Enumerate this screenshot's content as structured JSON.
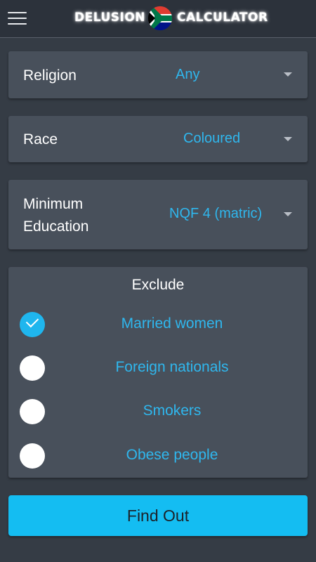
{
  "header": {
    "logo_left": "DELUSION",
    "logo_right": "CALCULATOR",
    "menu_icon": "hamburger-menu-icon",
    "flag_icon": "south-africa-flag-icon"
  },
  "filters": {
    "religion": {
      "label": "Religion",
      "value": "Any"
    },
    "race": {
      "label": "Race",
      "value": "Coloured"
    },
    "education": {
      "label_line1": "Minimum",
      "label_line2": "Education",
      "value": "NQF 4 (matric)"
    }
  },
  "exclude": {
    "title": "Exclude",
    "options": [
      {
        "label": "Married women",
        "checked": true
      },
      {
        "label": "Foreign nationals",
        "checked": false
      },
      {
        "label": "Smokers",
        "checked": false
      },
      {
        "label": "Obese people",
        "checked": false
      }
    ]
  },
  "action": {
    "label": "Find Out"
  },
  "colors": {
    "background": "#353c45",
    "card": "#48505b",
    "accent": "#2fb7ee",
    "button": "#14bdf2"
  }
}
